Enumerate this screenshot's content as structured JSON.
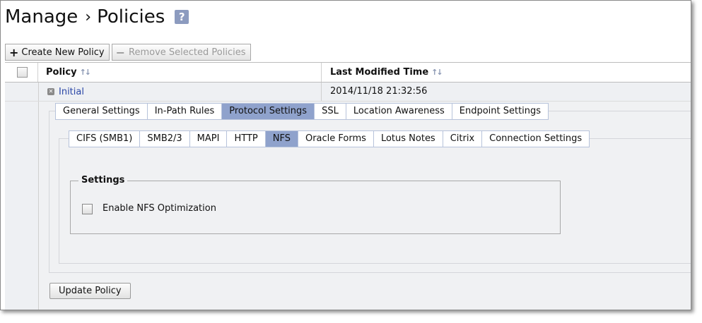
{
  "header": {
    "section": "Manage",
    "separator": "›",
    "title": "Policies",
    "help_glyph": "?"
  },
  "toolbar": {
    "create_label": "Create New Policy",
    "create_icon": "plus-icon",
    "remove_label": "Remove Selected Policies",
    "remove_icon": "minus-icon"
  },
  "table": {
    "columns": [
      "Policy",
      "Last Modified Time"
    ],
    "sort_glyph": "↑↓",
    "rows": [
      {
        "name": "Initial",
        "modified": "2014/11/18 21:32:56"
      }
    ]
  },
  "policy_tabs": {
    "items": [
      "General Settings",
      "In-Path Rules",
      "Protocol Settings",
      "SSL",
      "Location Awareness",
      "Endpoint Settings"
    ],
    "active": "Protocol Settings"
  },
  "protocol_tabs": {
    "items": [
      "CIFS (SMB1)",
      "SMB2/3",
      "MAPI",
      "HTTP",
      "NFS",
      "Oracle Forms",
      "Lotus Notes",
      "Citrix",
      "Connection Settings"
    ],
    "active": "NFS"
  },
  "settings": {
    "legend": "Settings",
    "options": [
      {
        "label": "Enable NFS Optimization",
        "checked": false
      }
    ]
  },
  "actions": {
    "update_label": "Update Policy"
  },
  "colors": {
    "active_tab": "#8fa2cc",
    "tab_border": "#b7c3db",
    "link": "#2a46a6",
    "help_icon": "#8c9bbf",
    "row_bg": "#eef0f3"
  }
}
